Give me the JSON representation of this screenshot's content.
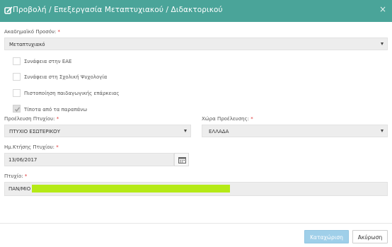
{
  "header": {
    "title": "Προβολή / Επεξεργασία Μεταπτυχιακού / Διδακτορικού",
    "close_symbol": "×",
    "background": "#4aa499"
  },
  "form": {
    "academic_qualification": {
      "label": "Ακαδημαϊκό Προσόν:",
      "required_mark": "*",
      "value": "Μεταπτυχιακό"
    },
    "checkboxes": [
      {
        "label": "Συνάφεια στην ΕΑΕ",
        "checked": false
      },
      {
        "label": "Συνάφεια στη Σχολική Ψυχολογία",
        "checked": false
      },
      {
        "label": "Πιστοποίηση παιδαγωγικής επάρκειας",
        "checked": false
      },
      {
        "label": "Τίποτα από τα παραπάνω",
        "checked": true
      }
    ],
    "degree_origin": {
      "label": "Προέλευση Πτυχίου:",
      "required_mark": "*",
      "value": "ΠΤΥΧΙΟ ΕΣΩΤΕΡΙΚΟΥ"
    },
    "origin_country": {
      "label": "Χώρα Προέλευσης:",
      "required_mark": "*",
      "value": "ΕΛΛΑΔΑ"
    },
    "acquisition_date": {
      "label": "Ημ.Κτήσης Πτυχίου:",
      "required_mark": "*",
      "value": "13/06/2017"
    },
    "degree": {
      "label": "Πτυχίο:",
      "required_mark": "*",
      "value": "ΠΑΝ/ΜΙΟ"
    }
  },
  "footer": {
    "submit_label": "Καταχώριση",
    "cancel_label": "Ακύρωση"
  }
}
